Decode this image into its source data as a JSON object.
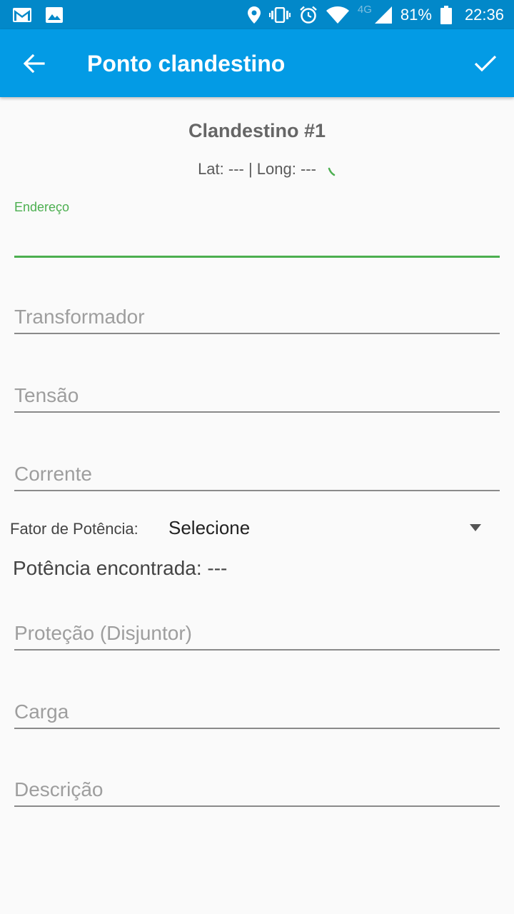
{
  "status_bar": {
    "network_type": "4G",
    "battery_percent": "81%",
    "time": "22:36",
    "icons": [
      "gmail-icon",
      "image-icon",
      "location-icon",
      "vibrate-icon",
      "alarm-icon",
      "wifi-icon",
      "signal-icon",
      "battery-icon"
    ]
  },
  "app_bar": {
    "title": "Ponto clandestino",
    "back_icon": "arrow-back-icon",
    "confirm_icon": "check-icon",
    "color": "#039be5"
  },
  "record": {
    "title": "Clandestino #1",
    "coordinates": "Lat: --- | Long: ---"
  },
  "form": {
    "endereco": {
      "label": "Endereço",
      "value": ""
    },
    "transformador": {
      "placeholder": "Transformador"
    },
    "tensao": {
      "placeholder": "Tensão"
    },
    "corrente": {
      "placeholder": "Corrente"
    },
    "fator_potencia": {
      "label": "Fator de Potência:",
      "selected": "Selecione"
    },
    "potencia_encontrada": "Potência encontrada: ---",
    "protecao": {
      "placeholder": "Proteção (Disjuntor)"
    },
    "carga": {
      "placeholder": "Carga"
    },
    "descricao": {
      "placeholder": "Descrição"
    }
  },
  "colors": {
    "accent": "#4caf50",
    "status_bar": "#0288c9"
  }
}
